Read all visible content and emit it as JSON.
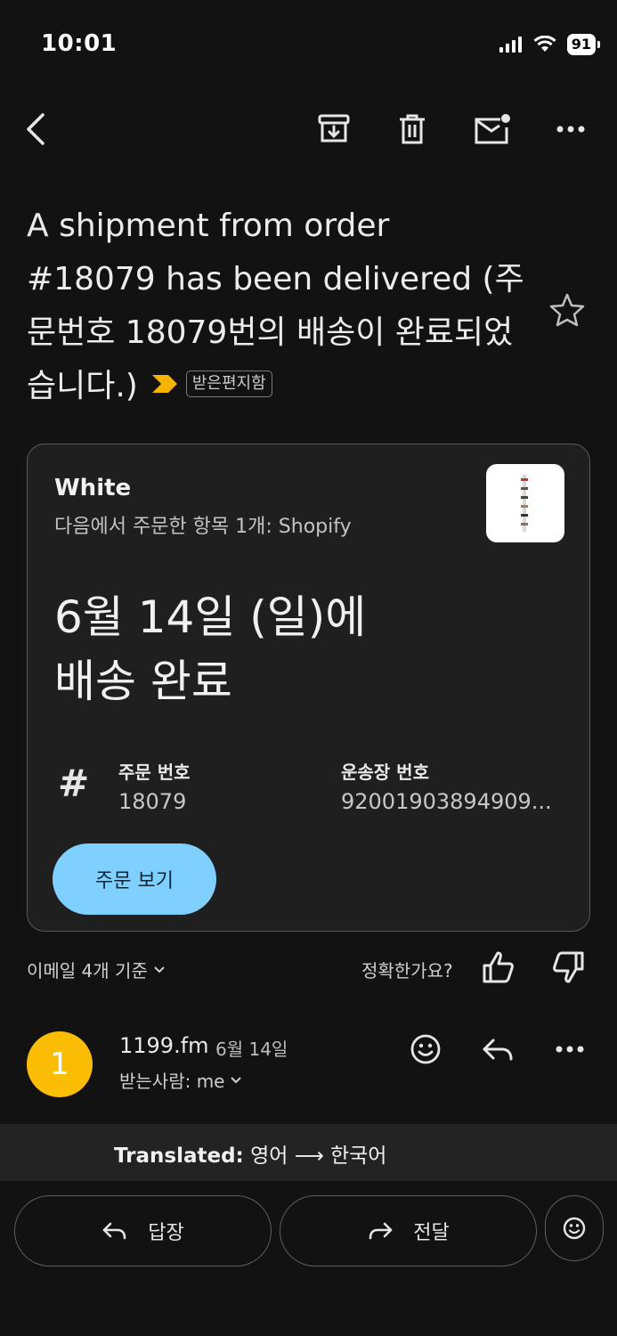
{
  "status_bar": {
    "time": "10:01",
    "battery": "91"
  },
  "subject": {
    "text": "A shipment from order #18079 has been delivered (주문번호 18079번의 배송이 완료되었습니다.)",
    "label_chip": "받은편지함"
  },
  "card": {
    "merchant": "White",
    "items_line": "다음에서 주문한 항목 1개: Shopify",
    "delivered_line1": "6월 14일 (일)에",
    "delivered_line2": "배송 완료",
    "order_label": "주문 번호",
    "order_value": "18079",
    "tracking_label": "운송장 번호",
    "tracking_value": "92001903894909...",
    "view_button": "주문 보기"
  },
  "feedback": {
    "thread_count": "이메일 4개 기준",
    "accurate_question": "정확한가요?"
  },
  "message": {
    "avatar_letter": "1",
    "sender": "1199.fm",
    "date": "6월 14일",
    "recipient": "받는사람: me"
  },
  "translation": {
    "label": "Translated:",
    "languages": "영어 ⟶ 한국어"
  },
  "actions": {
    "reply": "답장",
    "forward": "전달"
  },
  "colors": {
    "accent_button": "#7fcfff",
    "avatar": "#fbbc04",
    "important": "#f6b400",
    "background": "#121212"
  }
}
